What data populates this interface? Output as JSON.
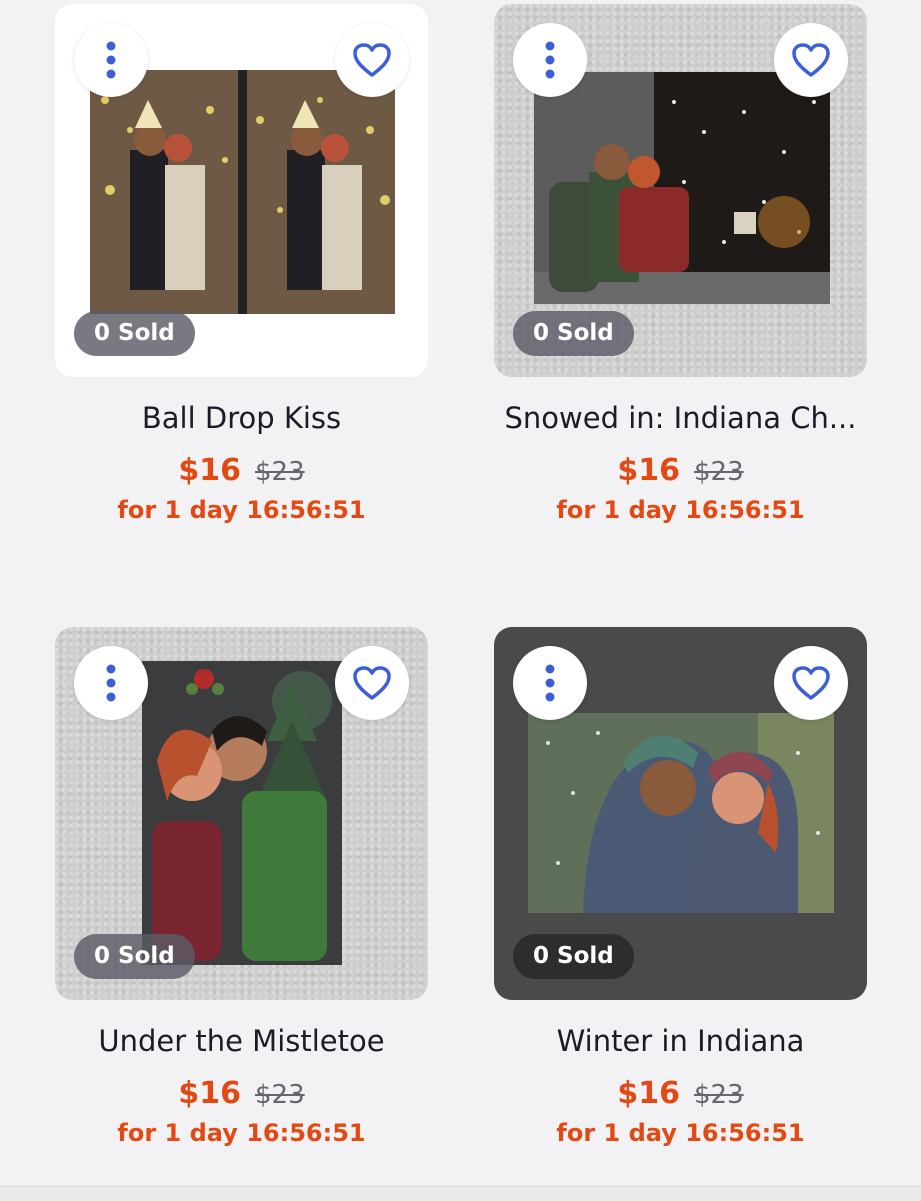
{
  "accent_color": "#e34a13",
  "heart_color": "#3d5fd6",
  "products": [
    {
      "title": "Ball Drop Kiss",
      "sold_badge": "0 Sold",
      "price": "$16",
      "original_price": "$23",
      "countdown": "for 1 day 16:56:51",
      "menu_icon": "more-vertical-icon",
      "favorite_icon": "heart-outline-icon"
    },
    {
      "title": "Snowed in: Indiana Ch...",
      "sold_badge": "0 Sold",
      "price": "$16",
      "original_price": "$23",
      "countdown": "for 1 day 16:56:51",
      "menu_icon": "more-vertical-icon",
      "favorite_icon": "heart-outline-icon"
    },
    {
      "title": "Under the Mistletoe",
      "sold_badge": "0 Sold",
      "price": "$16",
      "original_price": "$23",
      "countdown": "for 1 day 16:56:51",
      "menu_icon": "more-vertical-icon",
      "favorite_icon": "heart-outline-icon"
    },
    {
      "title": "Winter in Indiana",
      "sold_badge": "0 Sold",
      "price": "$16",
      "original_price": "$23",
      "countdown": "for 1 day 16:56:51",
      "menu_icon": "more-vertical-icon",
      "favorite_icon": "heart-outline-icon"
    }
  ]
}
